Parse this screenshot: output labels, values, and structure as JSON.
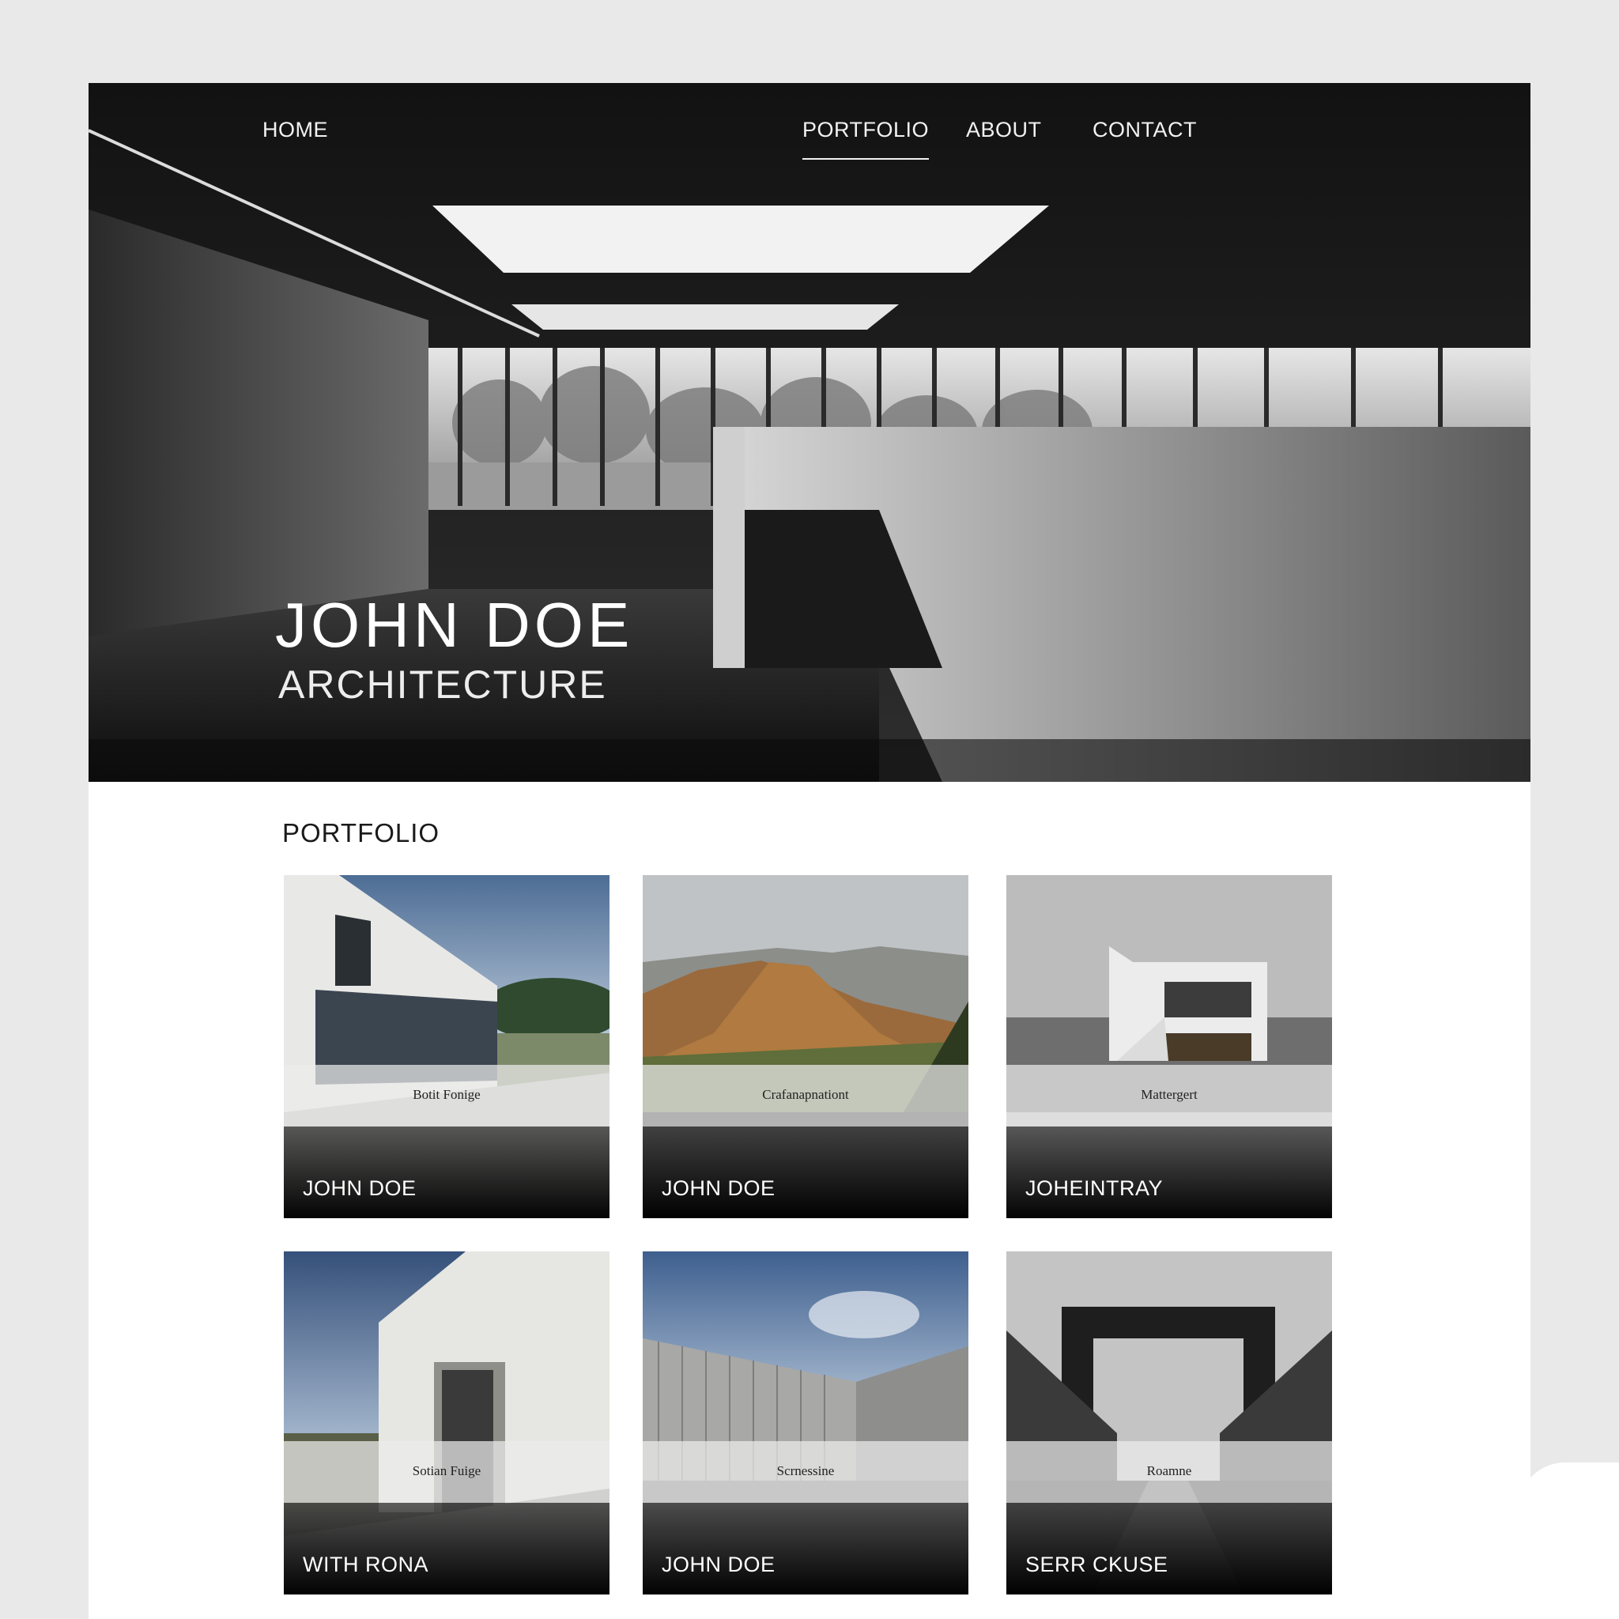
{
  "nav": {
    "home": "HOME",
    "portfolio": "PORTFOLIO",
    "about": "ABOUT",
    "contact": "CONTACT"
  },
  "hero": {
    "title": "JOHN DOE",
    "subtitle": "ARCHITECTURE"
  },
  "portfolio": {
    "heading": "PORTFOLIO",
    "cards": [
      {
        "caption": "Botit Fonige",
        "name": "JOHN DOE"
      },
      {
        "caption": "Crafanapnationt",
        "name": "JOHN DOE"
      },
      {
        "caption": "Mattergert",
        "name": "JOHEINTRAY"
      },
      {
        "caption": "Sotian Fuige",
        "name": "WITH RONA"
      },
      {
        "caption": "Scrnessine",
        "name": "JOHN DOE"
      },
      {
        "caption": "Roamne",
        "name": "SERR CKUSE"
      }
    ]
  },
  "colors": {
    "page_background": "#e9e9ea",
    "content_background": "#ffffff",
    "hero_dark": "#1c1c1c",
    "nav_text": "#f2f2f2"
  }
}
